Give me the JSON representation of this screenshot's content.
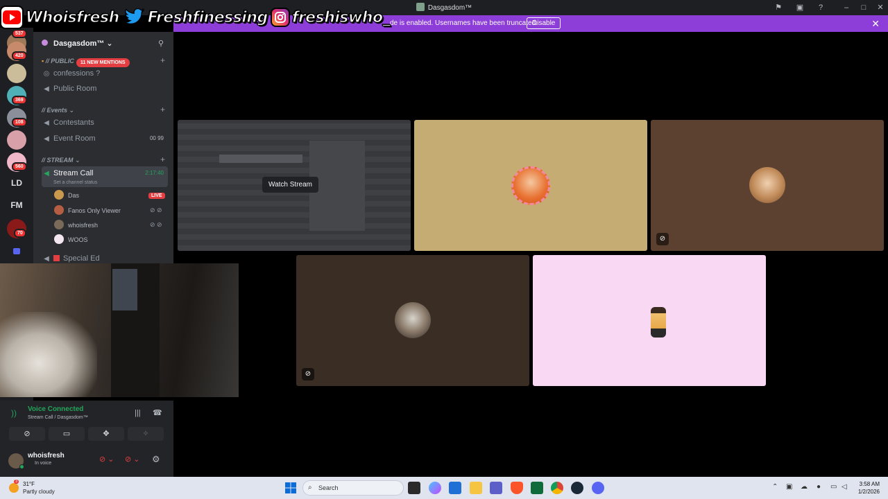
{
  "window": {
    "title": "Dasgasdom™"
  },
  "overlay": {
    "youtube": "Whoisfresh",
    "twitter": "Freshfinessing",
    "instagram": "freshiswho_"
  },
  "notice": {
    "message": "de is enabled. Usernames have been truncated.",
    "button": "Disable"
  },
  "rail": {
    "badges": [
      "537",
      "420",
      "369",
      "108",
      "560",
      "70"
    ],
    "text_servers": [
      "LD",
      "FM"
    ]
  },
  "sidebar": {
    "server_name": "Dasgasdom™",
    "mentions": "11 NEW MENTIONS",
    "categories": {
      "public": "// PUBLIC",
      "events": "// Events",
      "stream": "// STREAM"
    },
    "channels": {
      "confessions": "confessions ?",
      "public_room": "Public Room",
      "contestants": "Contestants",
      "event_room": "Event Room",
      "event_counts": "00  99",
      "stream_call": "Stream Call",
      "stream_timer": "2:17:40",
      "stream_status": "Set a channel status",
      "special_ed": "Special Ed"
    },
    "users": [
      {
        "name": "Das",
        "color": "#c99a4d"
      },
      {
        "name": "Fanos Only Viewer",
        "color": "#b55e43"
      },
      {
        "name": "whoisfresh",
        "color": "#7a6a5a"
      },
      {
        "name": "WOOS",
        "color": "#f3e6f0"
      }
    ],
    "live_label": "LIVE"
  },
  "voice": {
    "status": "Voice Connected",
    "channel": "Stream Call / Dasgasdom™",
    "username": "whoisfresh",
    "user_status": "In voice"
  },
  "tiles": {
    "watch_stream": "Watch Stream",
    "colors": {
      "tile2": "#c4ac72",
      "tile3": "#5c4030",
      "tile4": "#3a2d24",
      "tile5": "#f8d8f2"
    }
  },
  "taskbar": {
    "temperature": "31°F",
    "weather": "Partly cloudy",
    "search": "Search",
    "time": "3:58 AM",
    "date": "1/2/2026",
    "weather_badge": "3"
  },
  "colors": {
    "accent_purple": "#8d3dd8",
    "voice_green": "#23a55a",
    "live_red": "#e33f42"
  }
}
